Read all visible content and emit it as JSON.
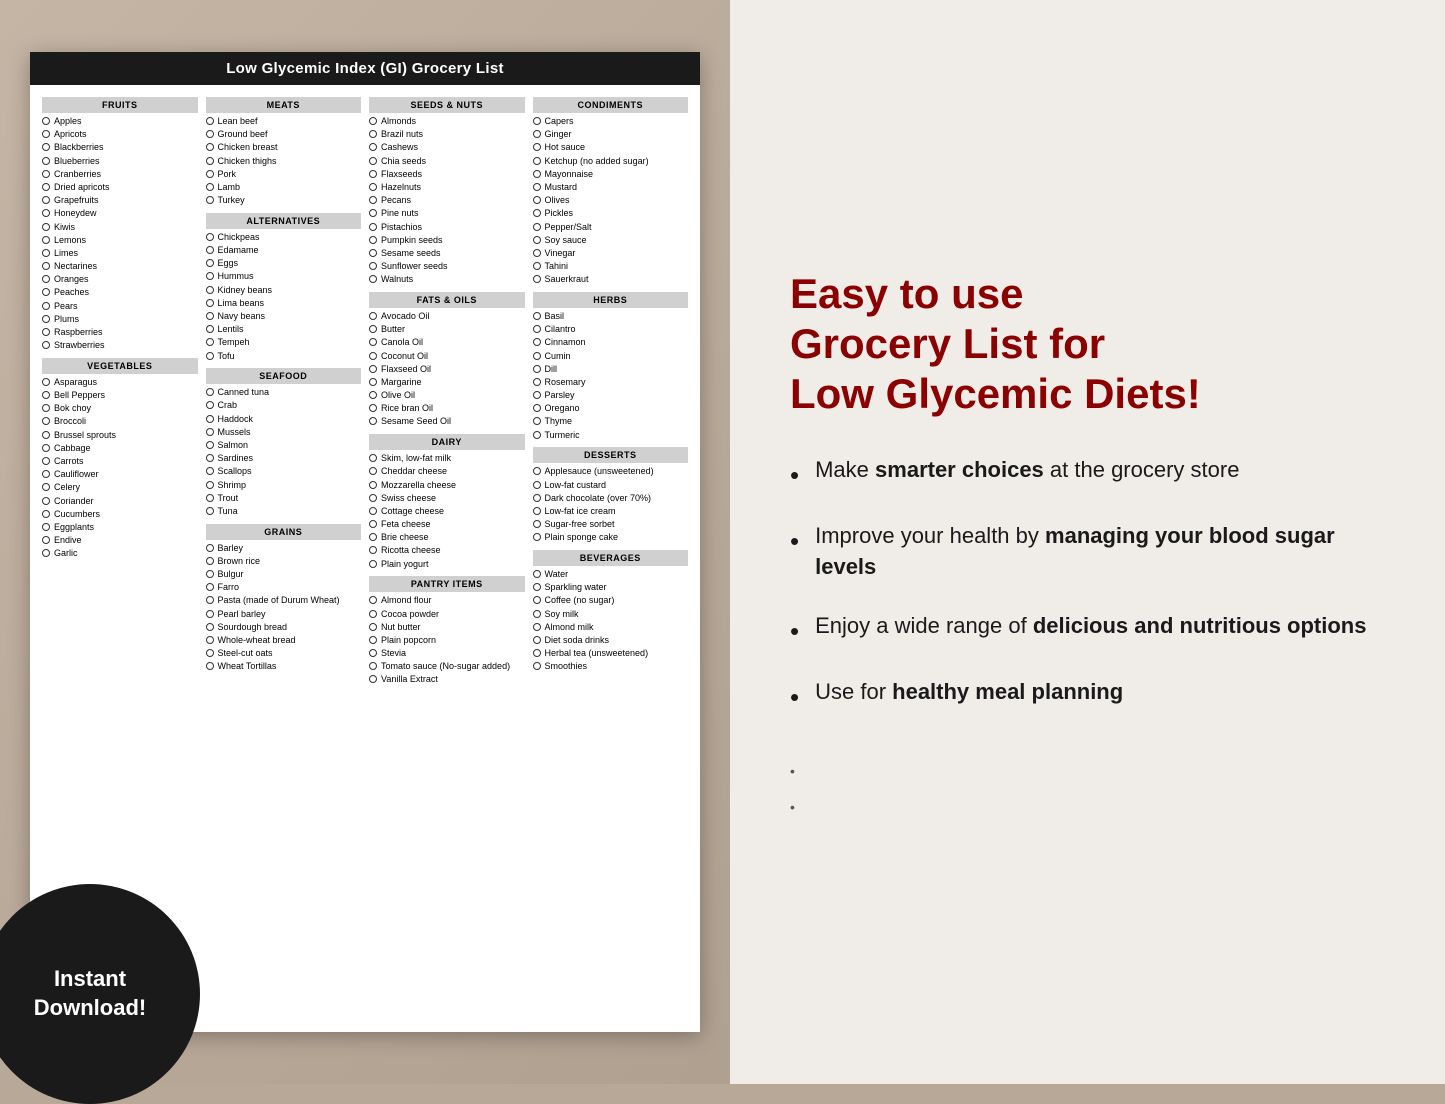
{
  "document": {
    "title": "Low Glycemic Index (GI) Grocery List",
    "columns": [
      {
        "sections": [
          {
            "header": "FRUITS",
            "items": [
              "Apples",
              "Apricots",
              "Blackberries",
              "Blueberries",
              "Cranberries",
              "Dried apricots",
              "Grapefruits",
              "Honeydew",
              "Kiwis",
              "Lemons",
              "Limes",
              "Nectarines",
              "Oranges",
              "Peaches",
              "Pears",
              "Plums",
              "Raspberries",
              "Strawberries"
            ]
          },
          {
            "header": "VEGETABLES",
            "items": [
              "Asparagus",
              "Bell Peppers",
              "Bok choy",
              "Broccoli",
              "Brussel sprouts",
              "Cabbage",
              "Carrots",
              "Cauliflower",
              "Celery",
              "Coriander",
              "Cucumbers",
              "Eggplants",
              "Endive",
              "Garlic"
            ]
          }
        ]
      },
      {
        "sections": [
          {
            "header": "MEATS",
            "items": [
              "Lean beef",
              "Ground beef",
              "Chicken breast",
              "Chicken thighs",
              "Pork",
              "Lamb",
              "Turkey"
            ]
          },
          {
            "header": "ALTERNATIVES",
            "items": [
              "Chickpeas",
              "Edamame",
              "Eggs",
              "Hummus",
              "Kidney beans",
              "Lima beans",
              "Navy beans",
              "Lentils",
              "Tempeh",
              "Tofu"
            ]
          },
          {
            "header": "SEAFOOD",
            "items": [
              "Canned tuna",
              "Crab",
              "Haddock",
              "Mussels",
              "Salmon",
              "Sardines",
              "Scallops",
              "Shrimp",
              "Trout",
              "Tuna"
            ]
          },
          {
            "header": "GRAINS",
            "items": [
              "Barley",
              "Brown rice",
              "Bulgur",
              "Farro",
              "Pasta (made of Durum Wheat)",
              "Pearl barley",
              "Sourdough bread",
              "Whole-wheat bread",
              "Steel-cut oats",
              "Wheat Tortillas"
            ]
          }
        ]
      },
      {
        "sections": [
          {
            "header": "SEEDS & NUTS",
            "items": [
              "Almonds",
              "Brazil nuts",
              "Cashews",
              "Chia seeds",
              "Flaxseeds",
              "Hazelnuts",
              "Pecans",
              "Pine nuts",
              "Pistachios",
              "Pumpkin seeds",
              "Sesame seeds",
              "Sunflower seeds",
              "Walnuts"
            ]
          },
          {
            "header": "FATS & OILS",
            "items": [
              "Avocado Oil",
              "Butter",
              "Canola Oil",
              "Coconut Oil",
              "Flaxseed Oil",
              "Margarine",
              "Olive Oil",
              "Rice bran Oil",
              "Sesame Seed Oil"
            ]
          },
          {
            "header": "DAIRY",
            "items": [
              "Skim, low-fat milk",
              "Cheddar cheese",
              "Mozzarella cheese",
              "Swiss cheese",
              "Cottage cheese",
              "Feta cheese",
              "Brie cheese",
              "Ricotta cheese",
              "Plain yogurt"
            ]
          },
          {
            "header": "PANTRY ITEMS",
            "items": [
              "Almond flour",
              "Cocoa powder",
              "Nut butter",
              "Plain popcorn",
              "Stevia",
              "Tomato sauce (No-sugar added)",
              "Vanilla Extract"
            ]
          }
        ]
      },
      {
        "sections": [
          {
            "header": "CONDIMENTS",
            "items": [
              "Capers",
              "Ginger",
              "Hot sauce",
              "Ketchup (no added sugar)",
              "Mayonnaise",
              "Mustard",
              "Olives",
              "Pickles",
              "Pepper/Salt",
              "Soy sauce",
              "Vinegar",
              "Tahini",
              "Sauerkraut"
            ]
          },
          {
            "header": "HERBS",
            "items": [
              "Basil",
              "Cilantro",
              "Cinnamon",
              "Cumin",
              "Dill",
              "Rosemary",
              "Parsley",
              "Oregano",
              "Thyme",
              "Turmeric"
            ]
          },
          {
            "header": "DESSERTS",
            "items": [
              "Applesauce (unsweetened)",
              "Low-fat custard",
              "Dark chocolate (over 70%)",
              "Low-fat ice cream",
              "Sugar-free sorbet",
              "Plain sponge cake"
            ]
          },
          {
            "header": "BEVERAGES",
            "items": [
              "Water",
              "Sparkling water",
              "Coffee (no sugar)",
              "Soy milk",
              "Almond milk",
              "Diet soda drinks",
              "Herbal tea (unsweetened)",
              "Smoothies"
            ]
          }
        ]
      }
    ]
  },
  "instant_download": {
    "label": "Instant\nDownload!"
  },
  "right_panel": {
    "title": "Easy to use\nGrocery List for\nLow Glycemic Diets!",
    "bullets": [
      {
        "plain": "Make ",
        "bold": "smarter choices",
        "plain2": "\nat the grocery store"
      },
      {
        "plain": "Improve your health by ",
        "bold": "managing your blood sugar levels",
        "plain2": ""
      },
      {
        "plain": "Enjoy a wide range of ",
        "bold": "delicious and nutritious options",
        "plain2": ""
      },
      {
        "plain": "Use for ",
        "bold": "healthy meal planning",
        "plain2": ""
      }
    ]
  }
}
